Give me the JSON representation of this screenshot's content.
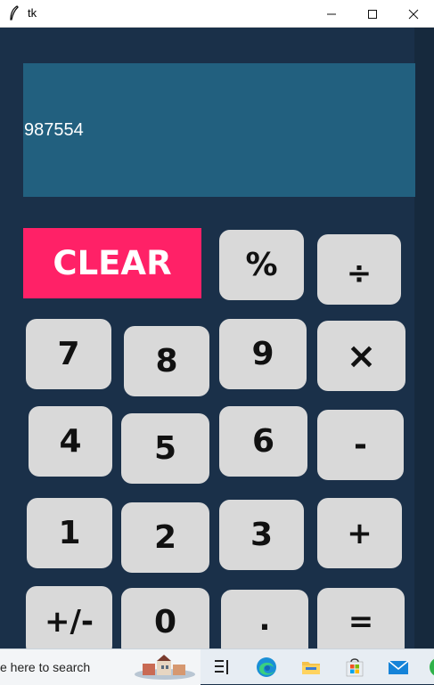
{
  "window": {
    "title": "tk",
    "controls": {
      "minimize": "—",
      "maximize": "☐",
      "close": "✕"
    }
  },
  "display": {
    "value": "987554"
  },
  "keys": {
    "clear": "CLEAR",
    "percent": "%",
    "divide": "÷",
    "seven": "7",
    "eight": "8",
    "nine": "9",
    "multiply": "×",
    "four": "4",
    "five": "5",
    "six": "6",
    "minus": "-",
    "one": "1",
    "two": "2",
    "three": "3",
    "plus": "+",
    "negate": "+/-",
    "zero": "0",
    "decimal": ".",
    "equals": "="
  },
  "taskbar": {
    "search_placeholder": "e here to search",
    "icons": [
      "search-highlight-icon",
      "task-view-icon",
      "edge-icon",
      "file-explorer-icon",
      "microsoft-store-icon",
      "mail-icon"
    ]
  },
  "colors": {
    "background": "#1a3049",
    "display": "#22607f",
    "key": "#d9d9d9",
    "clear": "#ff2167"
  }
}
